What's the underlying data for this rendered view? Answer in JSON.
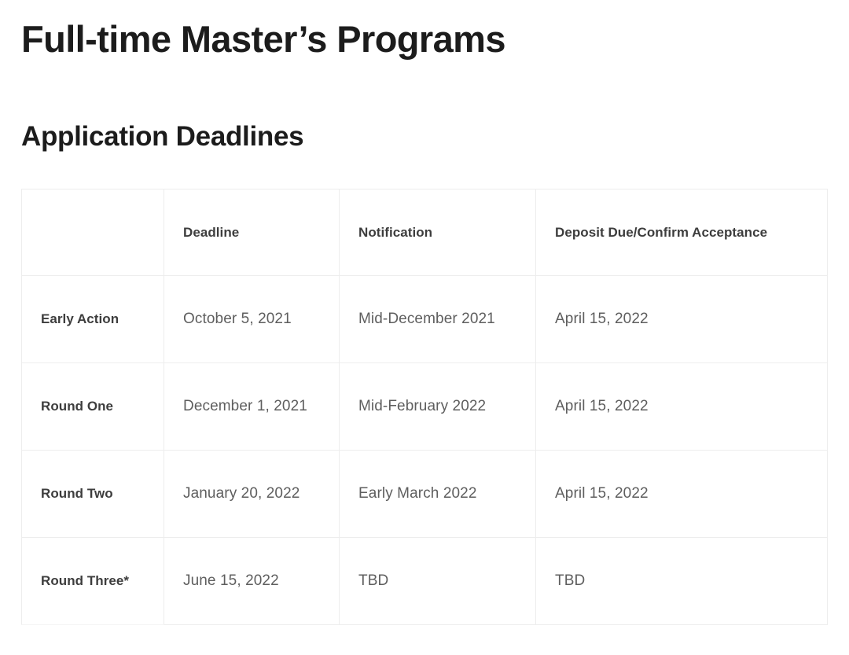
{
  "page_title": "Full-time Master’s Programs",
  "section_title": "Application Deadlines",
  "table": {
    "columns": [
      "",
      "Deadline",
      "Notification",
      "Deposit Due/Confirm Acceptance"
    ],
    "rows": [
      {
        "label": "Early Action",
        "deadline": "October 5, 2021",
        "notification": "Mid-December 2021",
        "deposit": "April 15, 2022"
      },
      {
        "label": "Round One",
        "deadline": "December 1, 2021",
        "notification": "Mid-February 2022",
        "deposit": "April 15, 2022"
      },
      {
        "label": "Round Two",
        "deadline": "January 20, 2022",
        "notification": "Early March 2022",
        "deposit": "April 15, 2022"
      },
      {
        "label": "Round Three*",
        "deadline": "June 15, 2022",
        "notification": "TBD",
        "deposit": "TBD"
      }
    ]
  },
  "colors": {
    "heading": "#1c1c1c",
    "table_header_text": "#3d3d3d",
    "cell_text": "#5e5e5e",
    "border": "#ededed",
    "background": "#ffffff"
  }
}
